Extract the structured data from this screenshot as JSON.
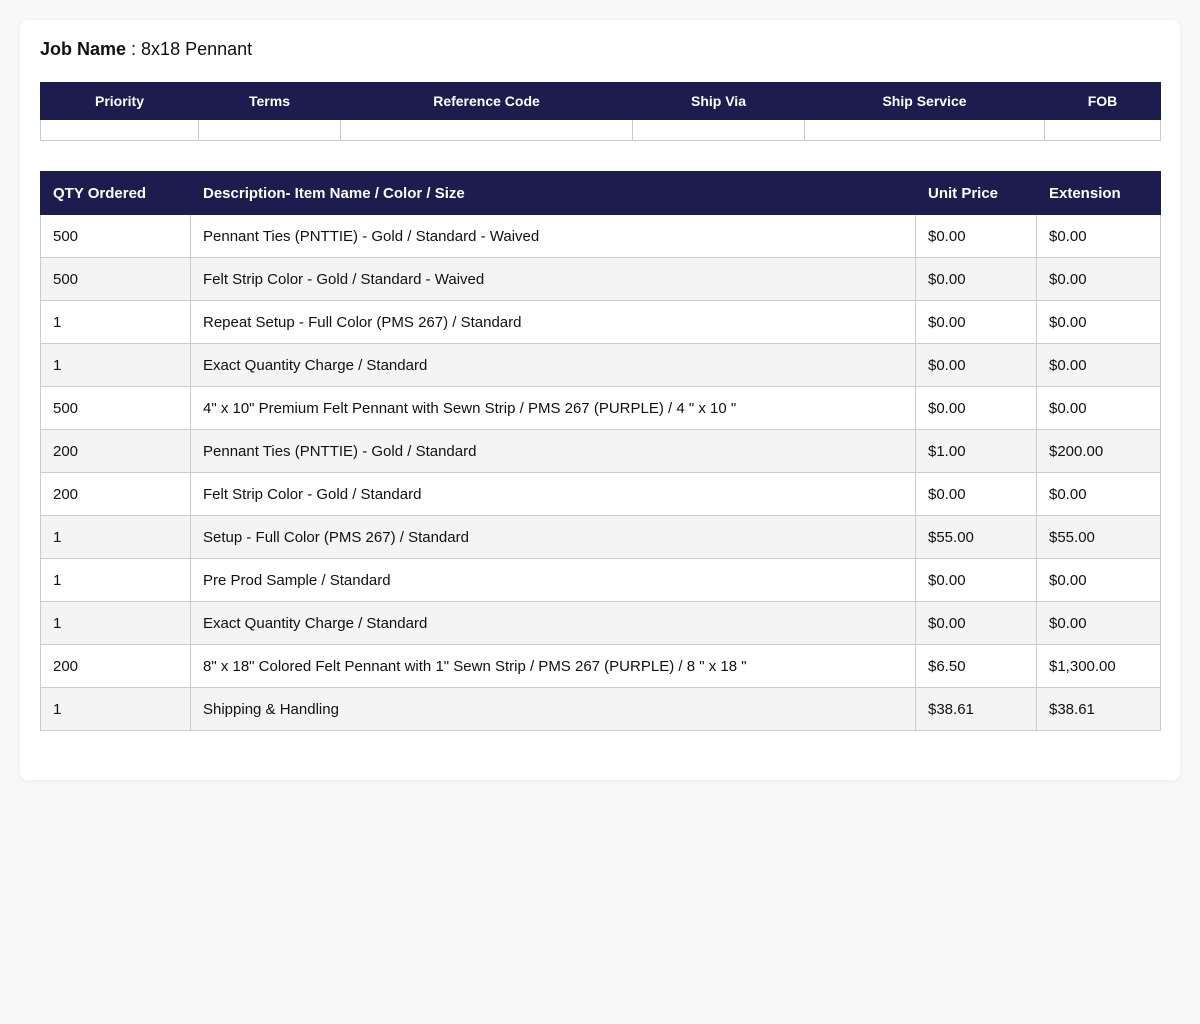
{
  "job": {
    "label": "Job Name",
    "separator": " : ",
    "value": "8x18 Pennant"
  },
  "shipping": {
    "headers": [
      "Priority",
      "Terms",
      "Reference Code",
      "Ship Via",
      "Ship Service",
      "FOB"
    ],
    "values": [
      "",
      "",
      "",
      "",
      "",
      ""
    ]
  },
  "items": {
    "headers": [
      "QTY Ordered",
      "Description- Item Name / Color / Size",
      "Unit Price",
      "Extension"
    ],
    "rows": [
      {
        "qty": "500",
        "desc": "Pennant Ties (PNTTIE) - Gold / Standard - Waived",
        "unit": "$0.00",
        "ext": "$0.00"
      },
      {
        "qty": "500",
        "desc": "Felt Strip Color - Gold / Standard - Waived",
        "unit": "$0.00",
        "ext": "$0.00"
      },
      {
        "qty": "1",
        "desc": "Repeat Setup - Full Color (PMS 267) / Standard",
        "unit": "$0.00",
        "ext": "$0.00"
      },
      {
        "qty": "1",
        "desc": "Exact Quantity Charge / Standard",
        "unit": "$0.00",
        "ext": "$0.00"
      },
      {
        "qty": "500",
        "desc": "4\" x 10\" Premium Felt Pennant with Sewn Strip / PMS 267 (PURPLE) / 4 \" x 10 \"",
        "unit": "$0.00",
        "ext": "$0.00"
      },
      {
        "qty": "200",
        "desc": "Pennant Ties (PNTTIE) - Gold / Standard",
        "unit": "$1.00",
        "ext": "$200.00"
      },
      {
        "qty": "200",
        "desc": "Felt Strip Color - Gold / Standard",
        "unit": "$0.00",
        "ext": "$0.00"
      },
      {
        "qty": "1",
        "desc": "Setup - Full Color (PMS 267) / Standard",
        "unit": "$55.00",
        "ext": "$55.00"
      },
      {
        "qty": "1",
        "desc": "Pre Prod Sample / Standard",
        "unit": "$0.00",
        "ext": "$0.00"
      },
      {
        "qty": "1",
        "desc": "Exact Quantity Charge / Standard",
        "unit": "$0.00",
        "ext": "$0.00"
      },
      {
        "qty": "200",
        "desc": "8\" x 18\" Colored Felt Pennant with 1\" Sewn Strip / PMS 267 (PURPLE) / 8 \" x 18 \"",
        "unit": "$6.50",
        "ext": "$1,300.00"
      },
      {
        "qty": "1",
        "desc": "Shipping & Handling",
        "unit": "$38.61",
        "ext": "$38.61"
      }
    ]
  },
  "colors": {
    "header_bg": "#1c1c4f",
    "header_text": "#ffffff",
    "row_alt": "#f4f4f4",
    "border": "#cccccc"
  }
}
